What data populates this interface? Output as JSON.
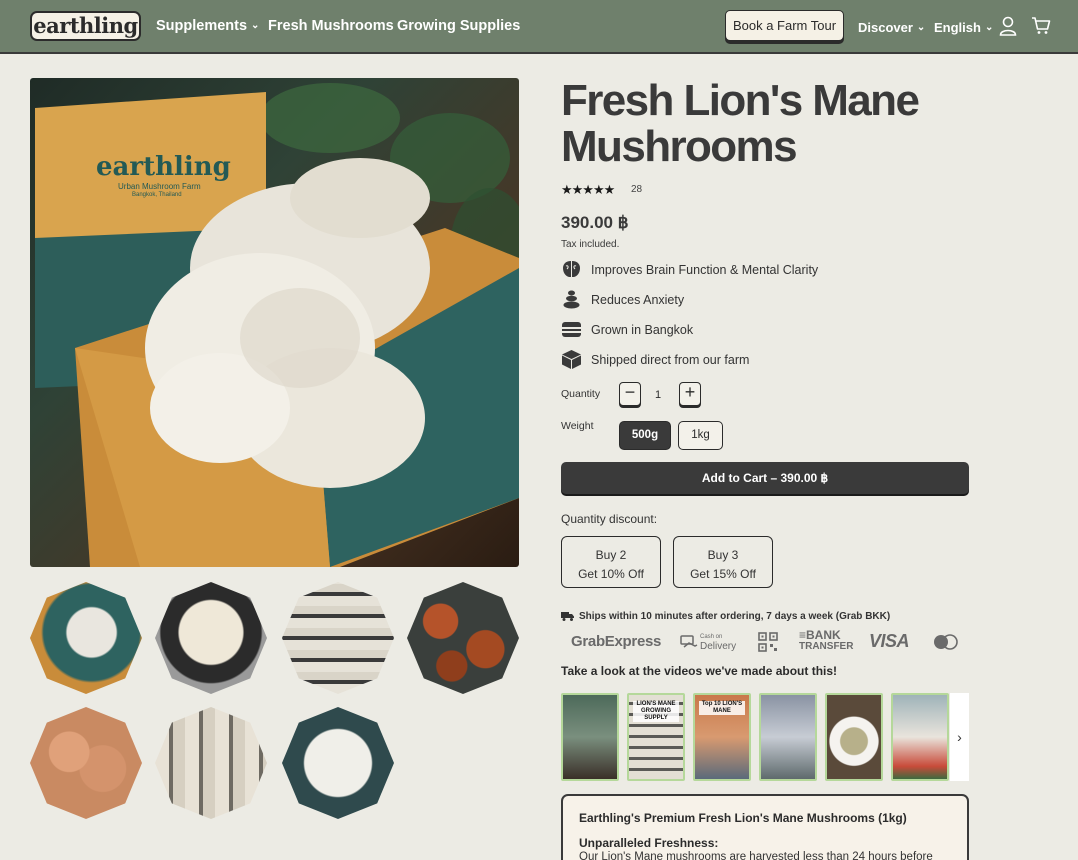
{
  "header": {
    "logo": "earthling",
    "nav": [
      {
        "label": "Supplements",
        "dropdown": true
      },
      {
        "label": "Fresh Mushrooms",
        "dropdown": false
      },
      {
        "label": "Growing Supplies",
        "dropdown": false
      }
    ],
    "tour_button": "Book a Farm Tour",
    "discover": "Discover",
    "language": "English",
    "icons": [
      "user-icon",
      "cart-icon"
    ]
  },
  "gallery": {
    "main_image_text": {
      "brand": "earthling",
      "tagline": "Urban Mushroom Farm",
      "location": "Bangkok, Thailand"
    },
    "thumbnails": [
      "lions-mane-in-box",
      "lions-mane-in-hand",
      "mushroom-grow-shelves",
      "grilled-mushroom-steaks",
      "lions-mane-clusters",
      "hanging-grow-bags",
      "lions-mane-close-up"
    ]
  },
  "product": {
    "title": "Fresh Lion's Mane Mushrooms",
    "stars": "★★★★★",
    "rating_count": "28",
    "price": "390.00 ฿",
    "tax_note": "Tax included.",
    "benefits": [
      {
        "icon": "brain-icon",
        "text": "Improves Brain Function & Mental Clarity"
      },
      {
        "icon": "stones-icon",
        "text": "Reduces Anxiety"
      },
      {
        "icon": "stripes-icon",
        "text": "Grown in Bangkok"
      },
      {
        "icon": "box-icon",
        "text": "Shipped direct from our farm"
      }
    ],
    "quantity_label": "Quantity",
    "quantity": "1",
    "weight_label": "Weight",
    "weights": [
      {
        "label": "500g",
        "selected": true
      },
      {
        "label": "1kg",
        "selected": false
      }
    ],
    "add_to_cart": "Add to Cart –  390.00 ฿",
    "quantity_discount_label": "Quantity discount:",
    "discounts": [
      {
        "line1": "Buy 2",
        "line2": "Get 10% Off"
      },
      {
        "line1": "Buy 3",
        "line2": "Get 15% Off"
      }
    ],
    "shipping": "Ships within 10 minutes after ordering, 7 days a week (Grab BKK)",
    "payment_methods": {
      "grab": "GrabExpress",
      "cod_line1": "Cash on",
      "cod_line2": "Delivery",
      "bank_line1": "≡BANK",
      "bank_line2": "TRANSFER",
      "visa": "VISA"
    },
    "videos_title": "Take a look at the videos we've made about this!",
    "videos": [
      {
        "caption": ""
      },
      {
        "caption": "LION'S MANE GROWING SUPPLY"
      },
      {
        "caption": "Top 10 LION'S MANE"
      },
      {
        "caption": ""
      },
      {
        "caption": ""
      },
      {
        "caption": ""
      }
    ],
    "description": {
      "title": "Earthling's Premium Fresh Lion's Mane Mushrooms (1kg)",
      "subtitle": "Unparalleled Freshness:",
      "body": "Our Lion's Mane mushrooms are harvested less than 24 hours before"
    }
  },
  "colors": {
    "header_bg": "#6f806c",
    "page_bg": "#ecebe4",
    "dark": "#3a3a3a",
    "video_border": "#b5d89a"
  }
}
